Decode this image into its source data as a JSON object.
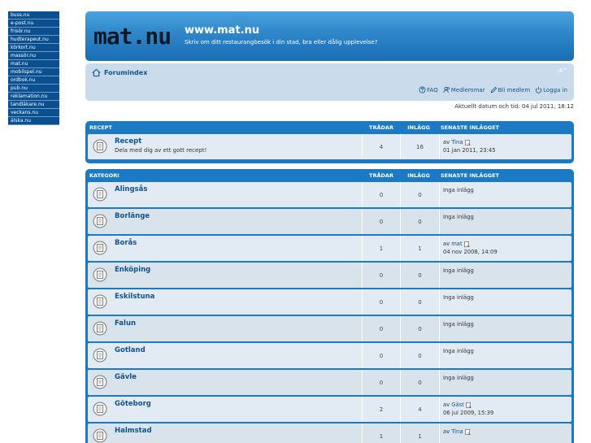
{
  "sites": [
    "buss.nu",
    "e-post.nu",
    "frisör.nu",
    "hudterapeut.nu",
    "körkort.nu",
    "massör.nu",
    "mat.nu",
    "mobilspel.nu",
    "ordbok.nu",
    "pub.nu",
    "reklamation.nu",
    "tandläkare.nu",
    "veckans.nu",
    "älska.nu"
  ],
  "header": {
    "logo_text": "mat.nu",
    "title": "www.mat.nu",
    "description": "Skriv om ditt restaurangbesök i din stad, bra eller dålig upplevelse?"
  },
  "nav": {
    "breadcrumb": "Forumindex",
    "font_size_label": "-A^",
    "links": {
      "faq": "FAQ",
      "members": "Medlemmar",
      "register": "Bli medlem",
      "login": "Logga in"
    }
  },
  "datetime": "Aktuellt datum och tid: 04 jul 2011, 18:12",
  "recipe_table": {
    "headers": {
      "name": "RECEPT",
      "topics": "TRÅDAR",
      "posts": "INLÄGG",
      "last": "SENASTE INLÄGGET"
    },
    "rows": [
      {
        "name": "Recept",
        "desc": "Dela med dig av ett gott recept!",
        "topics": "4",
        "posts": "16",
        "has_last": true,
        "by": "av",
        "author": "Tina",
        "date": "01 jan 2011, 23:45",
        "none": ""
      }
    ]
  },
  "category_table": {
    "headers": {
      "name": "KATEGORI",
      "topics": "TRÅDAR",
      "posts": "INLÄGG",
      "last": "SENASTE INLÄGGET"
    },
    "rows": [
      {
        "name": "Alingsås",
        "desc": "",
        "topics": "0",
        "posts": "0",
        "has_last": false,
        "by": "",
        "author": "",
        "date": "",
        "none": "Inga inlägg"
      },
      {
        "name": "Borlänge",
        "desc": "",
        "topics": "0",
        "posts": "0",
        "has_last": false,
        "by": "",
        "author": "",
        "date": "",
        "none": "Inga inlägg"
      },
      {
        "name": "Borås",
        "desc": "",
        "topics": "1",
        "posts": "1",
        "has_last": true,
        "by": "av",
        "author": "mat",
        "date": "04 nov 2008, 14:09",
        "none": ""
      },
      {
        "name": "Enköping",
        "desc": "",
        "topics": "0",
        "posts": "0",
        "has_last": false,
        "by": "",
        "author": "",
        "date": "",
        "none": "Inga inlägg"
      },
      {
        "name": "Eskilstuna",
        "desc": "",
        "topics": "0",
        "posts": "0",
        "has_last": false,
        "by": "",
        "author": "",
        "date": "",
        "none": "Inga inlägg"
      },
      {
        "name": "Falun",
        "desc": "",
        "topics": "0",
        "posts": "0",
        "has_last": false,
        "by": "",
        "author": "",
        "date": "",
        "none": "Inga inlägg"
      },
      {
        "name": "Gotland",
        "desc": "",
        "topics": "0",
        "posts": "0",
        "has_last": false,
        "by": "",
        "author": "",
        "date": "",
        "none": "Inga inlägg"
      },
      {
        "name": "Gävle",
        "desc": "",
        "topics": "0",
        "posts": "0",
        "has_last": false,
        "by": "",
        "author": "",
        "date": "",
        "none": "Inga inlägg"
      },
      {
        "name": "Göteborg",
        "desc": "",
        "topics": "2",
        "posts": "4",
        "has_last": true,
        "by": "av",
        "author": "Gäst",
        "date": "06 jul 2009, 15:39",
        "none": ""
      },
      {
        "name": "Halmstad",
        "desc": "",
        "topics": "1",
        "posts": "1",
        "has_last": true,
        "by": "av",
        "author": "Tina",
        "date": "",
        "none": ""
      }
    ]
  },
  "colors": {
    "accent": "#1c7ac4",
    "link": "#105289",
    "sitelist_bg": "#0a4f8f"
  }
}
